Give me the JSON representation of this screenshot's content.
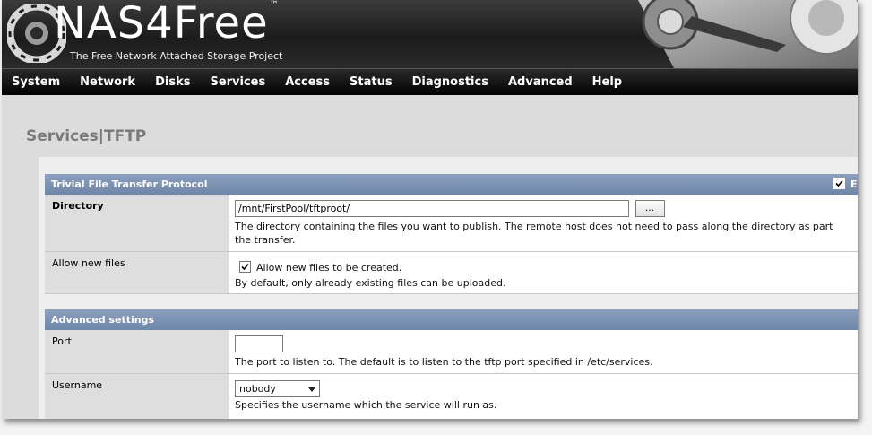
{
  "header": {
    "brand_main": "NAS4Free",
    "brand_tm": "™",
    "tagline": "The Free Network Attached Storage Project"
  },
  "nav": {
    "items": [
      "System",
      "Network",
      "Disks",
      "Services",
      "Access",
      "Status",
      "Diagnostics",
      "Advanced",
      "Help"
    ]
  },
  "page": {
    "title": "Services|TFTP"
  },
  "section_tftp": {
    "title": "Trivial File Transfer Protocol",
    "enable_label": "En",
    "enable_checked": true,
    "directory": {
      "label": "Directory",
      "value": "/mnt/FirstPool/tftproot/",
      "browse_label": "...",
      "desc_line1": "The directory containing the files you want to publish. The remote host does not need to pass along the directory as part",
      "desc_line2": "the transfer."
    },
    "allow_new_files": {
      "label": "Allow new files",
      "checked": true,
      "checkbox_text": "Allow new files to be created.",
      "desc": "By default, only already existing files can be uploaded."
    }
  },
  "section_advanced": {
    "title": "Advanced settings",
    "port": {
      "label": "Port",
      "value": "",
      "desc": "The port to listen to. The default is to listen to the tftp port specified in /etc/services."
    },
    "username": {
      "label": "Username",
      "selected": "nobody",
      "desc": "Specifies the username which the service will run as."
    }
  },
  "colors": {
    "section_head": "#7d93b3",
    "navbar": "#111111",
    "title_gray": "#7a7a7a"
  }
}
